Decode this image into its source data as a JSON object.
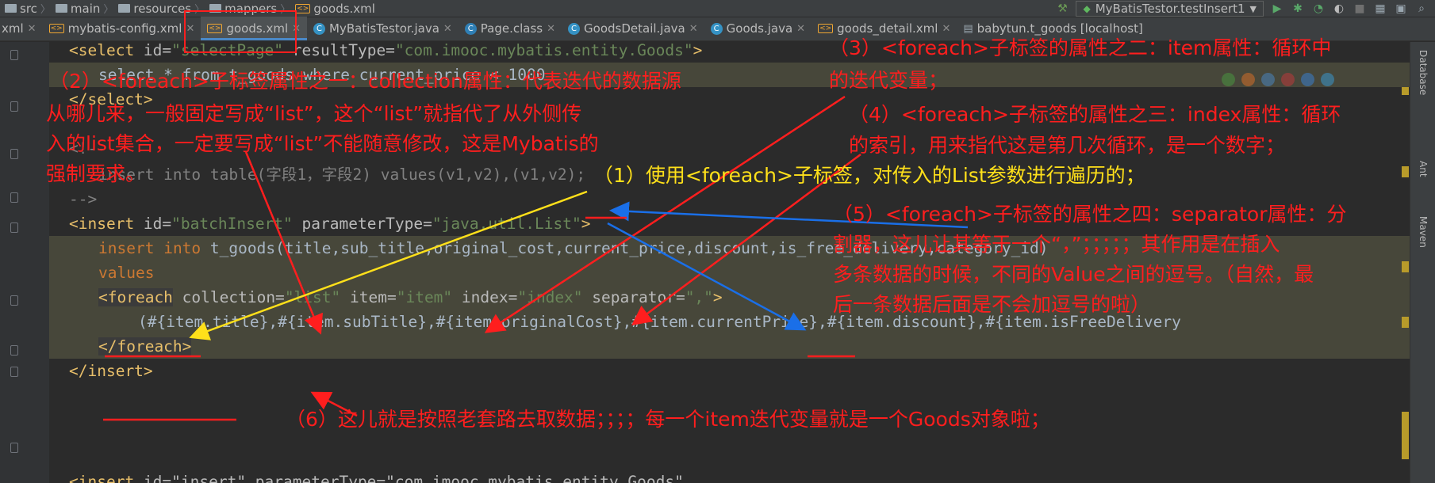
{
  "breadcrumb": [
    "src",
    "main",
    "resources",
    "mappers",
    "goods.xml"
  ],
  "run_config": "MyBatisTestor.testInsert1",
  "tabs": [
    {
      "label": "xml",
      "type": "xml"
    },
    {
      "label": "mybatis-config.xml",
      "type": "xml"
    },
    {
      "label": "goods.xml",
      "type": "xml",
      "active": true
    },
    {
      "label": "MyBatisTestor.java",
      "type": "java"
    },
    {
      "label": "Page.class",
      "type": "class"
    },
    {
      "label": "GoodsDetail.java",
      "type": "java"
    },
    {
      "label": "Goods.java",
      "type": "java"
    },
    {
      "label": "goods_detail.xml",
      "type": "xml"
    },
    {
      "label": "babytun.t_goods [localhost]",
      "type": "db"
    }
  ],
  "side_panels": [
    "Database",
    "Ant",
    "Maven"
  ],
  "code": {
    "l1_tag": "<select",
    "l1_attr": " id=",
    "l1_idval": "\"selectPage\"",
    "l1_attr2": " resultType=",
    "l1_val2": "\"com.imooc.mybatis.entity.Goods\"",
    "l1_end": ">",
    "l2": "select * from t_goods where current_price < 1000",
    "l3": "</select>",
    "l4": "<!--",
    "l5": "insert into table(字段1，字段2) values(v1,v2),(v1,v2);",
    "l6": "-->",
    "l7_tag": "<insert",
    "l7_attr": " id=",
    "l7_idval": "\"batchInsert\"",
    "l7_attr2": " parameterType=",
    "l7_val2": "\"java.util.List\"",
    "l7_end": ">",
    "l8_kw1": "insert",
    "l8_kw2": "into",
    "l8_rest": " t_goods(title,sub_title,original_cost,current_price,discount,is_free_delivery,category_id)",
    "l9": "values",
    "l10_tag": "<foreach",
    "l10_a1": " collection=",
    "l10_v1": "\"list\"",
    "l10_a2": " item=",
    "l10_v2": "\"item\"",
    "l10_a3": " index=",
    "l10_v3": "\"index\"",
    "l10_a4": " separator=",
    "l10_v4": "\",\"",
    "l10_end": ">",
    "l11": "(#{item.title},#{item.subTitle},#{item.originalCost},#{item.currentPrice},#{item.discount},#{item.isFreeDelivery",
    "l12": "</foreach>",
    "l13": "</insert>",
    "l14_tag": "<insert",
    "l14_rest": " id=\"insert\" parameterType=\"com.imooc.mybatis.entity.Goods\""
  },
  "annotations": {
    "a1": "（1）使用<foreach>子标签，对传入的List参数进行遍历的；",
    "a2_line1": "（2）<foreach>子标签属性之一：collection属性：代表迭代的数据源",
    "a2_line2": "从哪儿来，一般固定写成“list”，这个“list”就指代了从外侧传",
    "a2_line3": "入的list集合，一定要写成“list”不能随意修改，这是Mybatis的",
    "a2_line4": "强制要求。",
    "a3_line1": "（3）<foreach>子标签的属性之二：item属性：循环中",
    "a3_line2": "的迭代变量；",
    "a4_line1": "（4）<foreach>子标签的属性之三：index属性：循环",
    "a4_line2": "的索引，用来指代这是第几次循环，是一个数字；",
    "a5_line1": "（5）<foreach>子标签的属性之四：separator属性：分",
    "a5_line2": "割器，这儿让其等于一个“，”；；；；；其作用是在插入",
    "a5_line3": "多条数据的时候，不同的Value之间的逗号。（自然，最",
    "a5_line4": "后一条数据后面是不会加逗号的啦）",
    "a6": "（6）这儿就是按照老套路去取数据；；；；每一个item迭代变量就是一个Goods对象啦；"
  },
  "colors": {
    "annotation_red": "#ff1e1e",
    "annotation_yellow": "#ffe01a",
    "annotation_blue": "#1a6fe8",
    "xml_tag": "#e8bf6a",
    "xml_value": "#6a8759",
    "keyword": "#cc7832"
  }
}
